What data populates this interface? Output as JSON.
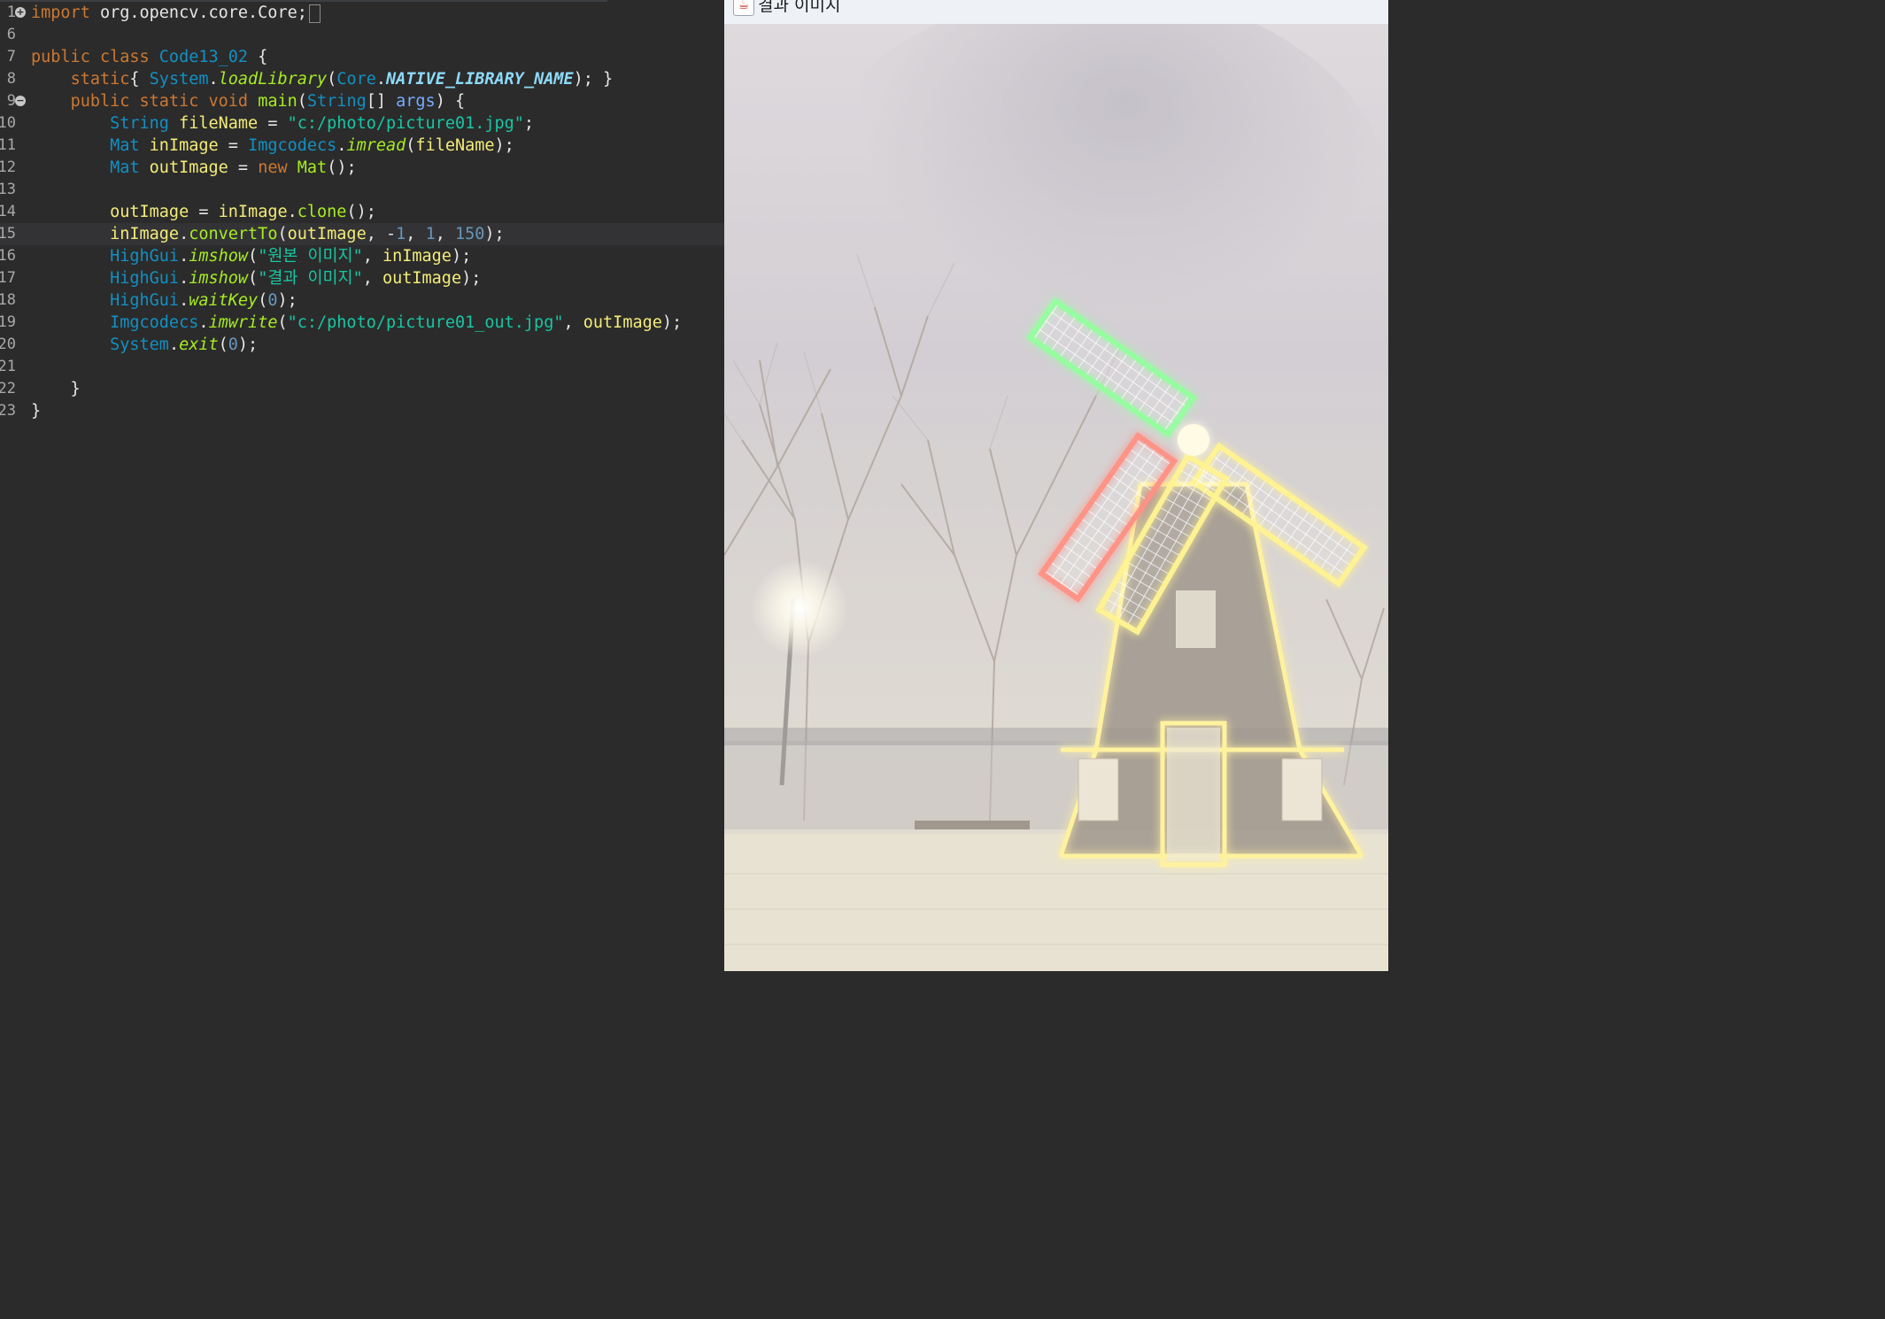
{
  "editor": {
    "lines": [
      {
        "num": "1",
        "fold": "+",
        "tokens": [
          [
            "kw",
            "import"
          ],
          [
            "pl",
            " org.opencv.core.Core;"
          ]
        ]
      },
      {
        "num": "6",
        "tokens": []
      },
      {
        "num": "7",
        "tokens": [
          [
            "kw",
            "public class "
          ],
          [
            "ty",
            "Code13_02"
          ],
          [
            "pl",
            " {"
          ]
        ]
      },
      {
        "num": "8",
        "tokens": [
          [
            "pl",
            "    "
          ],
          [
            "kw",
            "static"
          ],
          [
            "pl",
            "{ "
          ],
          [
            "ty",
            "System"
          ],
          [
            "pl",
            "."
          ],
          [
            "it",
            "loadLibrary"
          ],
          [
            "pl",
            "("
          ],
          [
            "ty",
            "Core"
          ],
          [
            "pl",
            "."
          ],
          [
            "cn",
            "NATIVE_LIBRARY_NAME"
          ],
          [
            "pl",
            "); }"
          ]
        ]
      },
      {
        "num": "9",
        "fold": "−",
        "tokens": [
          [
            "pl",
            "    "
          ],
          [
            "kw",
            "public static void "
          ],
          [
            "fn",
            "main"
          ],
          [
            "pl",
            "("
          ],
          [
            "ty",
            "String"
          ],
          [
            "pl",
            "[] "
          ],
          [
            "pm",
            "args"
          ],
          [
            "pl",
            ") {"
          ]
        ]
      },
      {
        "num": "10",
        "tokens": [
          [
            "pl",
            "        "
          ],
          [
            "ty",
            "String"
          ],
          [
            "pl",
            " "
          ],
          [
            "vr",
            "fileName"
          ],
          [
            "pl",
            " = "
          ],
          [
            "st",
            "\"c:/photo/picture01.jpg\""
          ],
          [
            "pl",
            ";"
          ]
        ]
      },
      {
        "num": "11",
        "tokens": [
          [
            "pl",
            "        "
          ],
          [
            "ty",
            "Mat"
          ],
          [
            "pl",
            " "
          ],
          [
            "vr",
            "inImage"
          ],
          [
            "pl",
            " = "
          ],
          [
            "ty",
            "Imgcodecs"
          ],
          [
            "pl",
            "."
          ],
          [
            "it",
            "imread"
          ],
          [
            "pl",
            "("
          ],
          [
            "vr",
            "fileName"
          ],
          [
            "pl",
            ");"
          ]
        ]
      },
      {
        "num": "12",
        "tokens": [
          [
            "pl",
            "        "
          ],
          [
            "ty",
            "Mat"
          ],
          [
            "pl",
            " "
          ],
          [
            "vr",
            "outImage"
          ],
          [
            "pl",
            " = "
          ],
          [
            "kw",
            "new "
          ],
          [
            "fn",
            "Mat"
          ],
          [
            "pl",
            "();"
          ]
        ]
      },
      {
        "num": "13",
        "tokens": []
      },
      {
        "num": "14",
        "tokens": [
          [
            "pl",
            "        "
          ],
          [
            "vr",
            "outImage"
          ],
          [
            "pl",
            " = "
          ],
          [
            "vr",
            "inImage"
          ],
          [
            "pl",
            "."
          ],
          [
            "fn",
            "clone"
          ],
          [
            "pl",
            "();"
          ]
        ]
      },
      {
        "num": "15",
        "current": true,
        "tokens": [
          [
            "pl",
            "        "
          ],
          [
            "vr",
            "inImage"
          ],
          [
            "pl",
            "."
          ],
          [
            "fn",
            "convertTo"
          ],
          [
            "pl",
            "("
          ],
          [
            "vr",
            "outImage"
          ],
          [
            "pl",
            ", -"
          ],
          [
            "nm",
            "1"
          ],
          [
            "pl",
            ", "
          ],
          [
            "nm",
            "1"
          ],
          [
            "pl",
            ", "
          ],
          [
            "nm",
            "150"
          ],
          [
            "pl",
            ");"
          ]
        ]
      },
      {
        "num": "16",
        "tokens": [
          [
            "pl",
            "        "
          ],
          [
            "ty",
            "HighGui"
          ],
          [
            "pl",
            "."
          ],
          [
            "it",
            "imshow"
          ],
          [
            "pl",
            "("
          ],
          [
            "st",
            "\"원본 이미지\""
          ],
          [
            "pl",
            ", "
          ],
          [
            "vr",
            "inImage"
          ],
          [
            "pl",
            ");"
          ]
        ]
      },
      {
        "num": "17",
        "tokens": [
          [
            "pl",
            "        "
          ],
          [
            "ty",
            "HighGui"
          ],
          [
            "pl",
            "."
          ],
          [
            "it",
            "imshow"
          ],
          [
            "pl",
            "("
          ],
          [
            "st",
            "\"결과 이미지\""
          ],
          [
            "pl",
            ", "
          ],
          [
            "vr",
            "outImage"
          ],
          [
            "pl",
            ");"
          ]
        ]
      },
      {
        "num": "18",
        "tokens": [
          [
            "pl",
            "        "
          ],
          [
            "ty",
            "HighGui"
          ],
          [
            "pl",
            "."
          ],
          [
            "it",
            "waitKey"
          ],
          [
            "pl",
            "("
          ],
          [
            "nm",
            "0"
          ],
          [
            "pl",
            ");"
          ]
        ]
      },
      {
        "num": "19",
        "tokens": [
          [
            "pl",
            "        "
          ],
          [
            "ty",
            "Imgcodecs"
          ],
          [
            "pl",
            "."
          ],
          [
            "it",
            "imwrite"
          ],
          [
            "pl",
            "("
          ],
          [
            "st",
            "\"c:/photo/picture01_out.jpg\""
          ],
          [
            "pl",
            ", "
          ],
          [
            "vr",
            "outImage"
          ],
          [
            "pl",
            ");"
          ]
        ]
      },
      {
        "num": "20",
        "tokens": [
          [
            "pl",
            "        "
          ],
          [
            "ty",
            "System"
          ],
          [
            "pl",
            "."
          ],
          [
            "it",
            "exit"
          ],
          [
            "pl",
            "("
          ],
          [
            "nm",
            "0"
          ],
          [
            "pl",
            ");"
          ]
        ]
      },
      {
        "num": "21",
        "tokens": []
      },
      {
        "num": "22",
        "tokens": [
          [
            "pl",
            "    }"
          ]
        ]
      },
      {
        "num": "23",
        "tokens": [
          [
            "pl",
            "}"
          ]
        ]
      }
    ]
  },
  "result_window": {
    "title": "결과 이미지",
    "icon": "java-cup-icon"
  },
  "colors": {
    "editor_bg": "#2b2b2b",
    "keyword": "#cc7832",
    "type": "#1290c3",
    "string": "#17c6a3",
    "method": "#a7ec21",
    "variable": "#f3ec79",
    "number": "#6897bb",
    "windmill_red": "#ff6a5a",
    "windmill_green": "#4dff6a",
    "windmill_yellow": "#fff27a"
  }
}
